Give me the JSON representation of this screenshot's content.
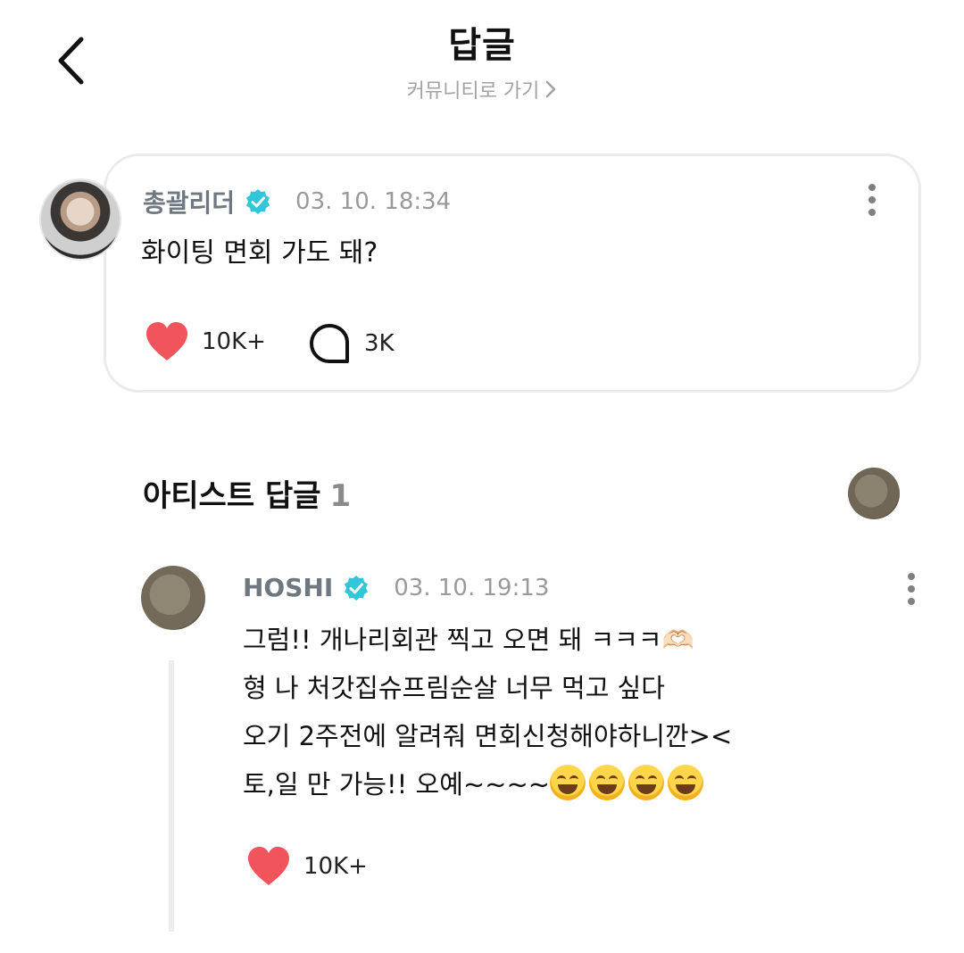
{
  "header": {
    "title": "답글",
    "community_link": "커뮤니티로 가기"
  },
  "post": {
    "author": "총괄리더",
    "timestamp": "03. 10. 18:34",
    "text": "화이팅 면회 가도 돼?",
    "likes": "10K+",
    "comments": "3K"
  },
  "section": {
    "title": "아티스트 답글",
    "count": "1"
  },
  "reply": {
    "author": "HOSHI",
    "timestamp": "03. 10. 19:13",
    "lines": [
      "그럼!! 개나리회관 찍고 오면 돼 ㅋㅋㅋ🫶🏻",
      "형 나 처갓집슈프림순살 너무 먹고 싶다",
      "오기 2주전에 알려줘 면회신청해야하니깐><",
      "토,일 만 가능!! 오예~~~~"
    ],
    "emoji_count": 4,
    "likes": "10K+"
  },
  "colors": {
    "heart": "#f2545b",
    "verified": "#32c6d9",
    "username": "#6f7780",
    "muted": "#9a9a9a"
  },
  "icons": [
    "chevron-left-icon",
    "chevron-right-icon",
    "verified-badge-icon",
    "more-vertical-icon",
    "heart-icon",
    "comment-bubble-icon",
    "grinning-squinting-face-emoji"
  ]
}
